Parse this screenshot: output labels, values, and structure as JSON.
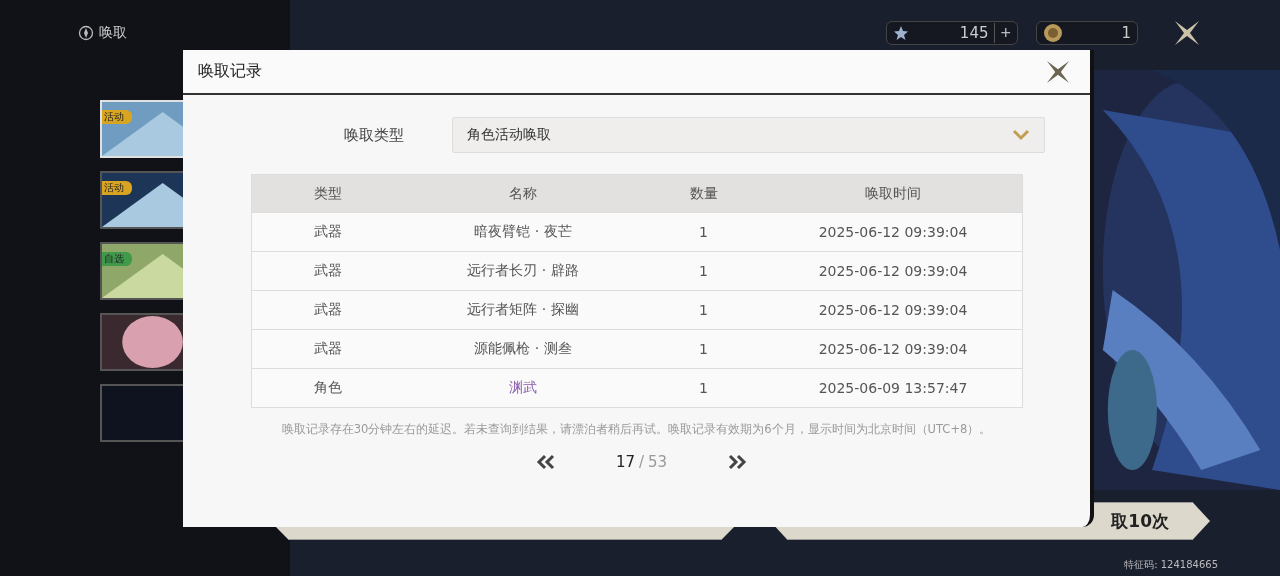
{
  "screen_title": "唤取",
  "currencies": [
    {
      "kind": "star",
      "amount": "145",
      "add": "+"
    },
    {
      "kind": "coin",
      "amount": "1"
    }
  ],
  "banners": [
    {
      "tag": "活动",
      "color": "#d9a521",
      "selected": true
    },
    {
      "tag": "活动",
      "color": "#d9a521",
      "selected": false
    },
    {
      "tag": "自选",
      "color": "#3f9a4a",
      "selected": false
    },
    {
      "selected": false
    },
    {
      "selected": false
    }
  ],
  "pull_buttons": [
    {
      "kind": "single"
    },
    {
      "kind": "ten",
      "label": "取10次"
    }
  ],
  "feature_code": "特征码: 124184665",
  "dialog": {
    "title": "唤取记录",
    "type_label": "唤取类型",
    "type_value": "角色活动唤取",
    "table": {
      "columns": [
        "类型",
        "名称",
        "数量",
        "唤取时间"
      ],
      "rows": [
        {
          "type": "武器",
          "name": "暗夜臂铠 · 夜芒",
          "count": "1",
          "time": "2025-06-12 09:39:04",
          "color": "#555555"
        },
        {
          "type": "武器",
          "name": "远行者长刃 · 辟路",
          "count": "1",
          "time": "2025-06-12 09:39:04",
          "color": "#555555"
        },
        {
          "type": "武器",
          "name": "远行者矩阵 · 探幽",
          "count": "1",
          "time": "2025-06-12 09:39:04",
          "color": "#555555"
        },
        {
          "type": "武器",
          "name": "源能佩枪 · 测叁",
          "count": "1",
          "time": "2025-06-12 09:39:04",
          "color": "#555555"
        },
        {
          "type": "角色",
          "name": "渊武",
          "count": "1",
          "time": "2025-06-09 13:57:47",
          "color": "#8a5cad"
        }
      ]
    },
    "note": "唤取记录存在30分钟左右的延迟。若未查询到结果，请漂泊者稍后再试。唤取记录有效期为6个月，显示时间为北京时间（UTC+8）。",
    "page": {
      "current": "17",
      "separator": "/",
      "total": "53"
    }
  }
}
